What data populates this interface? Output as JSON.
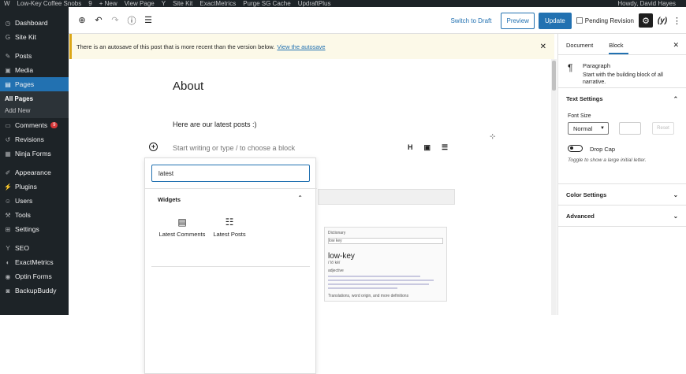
{
  "adminbar": {
    "items": [
      "W",
      "Low-Key Coffee Snobs",
      "9",
      "+ New",
      "View Page",
      "Y",
      "Site Kit",
      "ExactMetrics",
      "Purge SG Cache",
      "UpdraftPlus"
    ],
    "howdy": "Howdy, David Hayes"
  },
  "sidebar": {
    "items": [
      {
        "label": "Dashboard",
        "icon": "dashboard-icon"
      },
      {
        "label": "Site Kit",
        "icon": "sitekit-icon"
      },
      {
        "label": "Posts",
        "icon": "pin-icon"
      },
      {
        "label": "Media",
        "icon": "media-icon"
      },
      {
        "label": "Pages",
        "icon": "pages-icon"
      },
      {
        "label": "Comments",
        "icon": "comments-icon",
        "badge": "9"
      },
      {
        "label": "Revisions",
        "icon": "revisions-icon"
      },
      {
        "label": "Ninja Forms",
        "icon": "forms-icon"
      },
      {
        "label": "Appearance",
        "icon": "appearance-icon"
      },
      {
        "label": "Plugins",
        "icon": "plugins-icon"
      },
      {
        "label": "Users",
        "icon": "users-icon"
      },
      {
        "label": "Tools",
        "icon": "tools-icon"
      },
      {
        "label": "Settings",
        "icon": "settings-icon"
      },
      {
        "label": "SEO",
        "icon": "seo-icon"
      },
      {
        "label": "ExactMetrics",
        "icon": "exactmetrics-icon"
      },
      {
        "label": "Optin Forms",
        "icon": "optin-icon"
      },
      {
        "label": "BackupBuddy",
        "icon": "backup-icon"
      }
    ],
    "sub": [
      "All Pages",
      "Add New"
    ]
  },
  "toolbar": {
    "switch_draft": "Switch to Draft",
    "preview": "Preview",
    "update": "Update",
    "pending": "Pending Revision"
  },
  "notice": {
    "text": "There is an autosave of this post that is more recent than the version below.",
    "link": "View the autosave"
  },
  "editor": {
    "title": "About",
    "paragraph": "Here are our latest posts :)",
    "placeholder": "Start writing or type / to choose a block",
    "heading_tool": "H"
  },
  "inserter": {
    "search_value": "latest",
    "category": "Widgets",
    "blocks": [
      "Latest Comments",
      "Latest Posts"
    ]
  },
  "dictionary": {
    "header": "Dictionary",
    "search": "low key",
    "word": "low-key",
    "pron": "/ˈlōˈkē/",
    "pos": "adjective",
    "footer": "Translations, word origin, and more definitions"
  },
  "panel": {
    "tabs": [
      "Document",
      "Block"
    ],
    "block_name": "Paragraph",
    "block_desc": "Start with the building block of all narrative.",
    "text_settings": "Text Settings",
    "font_size_label": "Font Size",
    "font_size_value": "Normal",
    "reset": "Reset",
    "drop_cap": "Drop Cap",
    "drop_cap_help": "Toggle to show a large initial letter.",
    "color_settings": "Color Settings",
    "advanced": "Advanced"
  }
}
